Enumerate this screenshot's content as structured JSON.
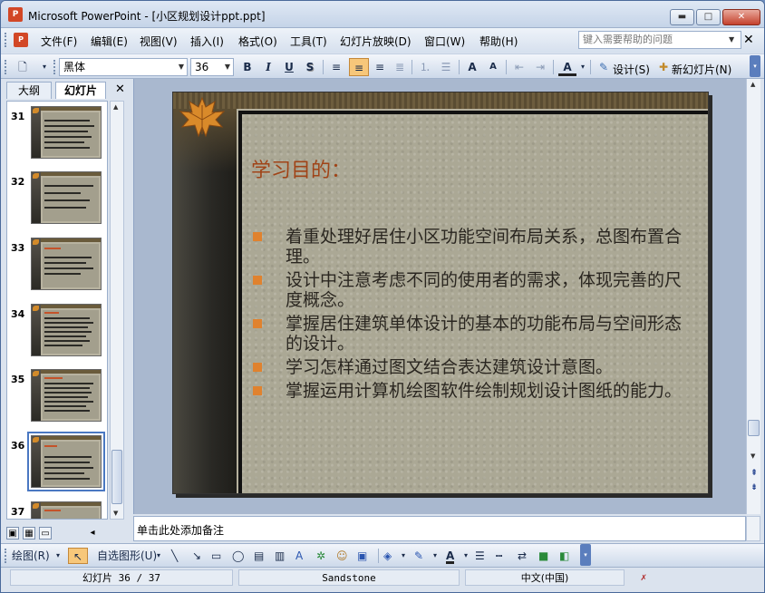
{
  "window": {
    "title": "Microsoft PowerPoint - [小区规划设计ppt.ppt]",
    "app_icon": "powerpoint-icon",
    "minimize_glyph": "▬",
    "maximize_glyph": "□",
    "close_glyph": "✕"
  },
  "menubar": {
    "items": [
      "文件(F)",
      "编辑(E)",
      "视图(V)",
      "插入(I)",
      "格式(O)",
      "工具(T)",
      "幻灯片放映(D)",
      "窗口(W)",
      "帮助(H)"
    ],
    "help_placeholder": "键入需要帮助的问题",
    "close_glyph": "✕"
  },
  "toolbar": {
    "font_name": "黑体",
    "font_size": "36",
    "bold": "B",
    "italic": "I",
    "underline": "U",
    "shadow": "S",
    "design_label": "设计(S)",
    "new_slide_label": "新幻灯片(N)"
  },
  "leftpanel": {
    "tab_outline": "大纲",
    "tab_slides": "幻灯片",
    "close_glyph": "✕",
    "thumbnails": [
      {
        "number": "31"
      },
      {
        "number": "32"
      },
      {
        "number": "33"
      },
      {
        "number": "34"
      },
      {
        "number": "35"
      },
      {
        "number": "36"
      },
      {
        "number": "37"
      }
    ]
  },
  "slide": {
    "title": "学习目的：",
    "bullets": [
      "着重处理好居住小区功能空间布局关系，总图布置合理。",
      "设计中注意考虑不同的使用者的需求，体现完善的尺度概念。",
      "掌握居住建筑单体设计的基本的功能布局与空间形态的设计。",
      "学习怎样通过图文结合表达建筑设计意图。",
      "掌握运用计算机绘图软件绘制规划设计图纸的能力。"
    ],
    "accent_color": "#e0822e",
    "title_color": "#a04418"
  },
  "notes": {
    "placeholder": "单击此处添加备注"
  },
  "drawbar": {
    "draw_label": "绘图(R)",
    "autoshapes_label": "自选图形(U)"
  },
  "statusbar": {
    "slide_position": "幻灯片 36 / 37",
    "design_template": "Sandstone",
    "language": "中文(中国)"
  }
}
